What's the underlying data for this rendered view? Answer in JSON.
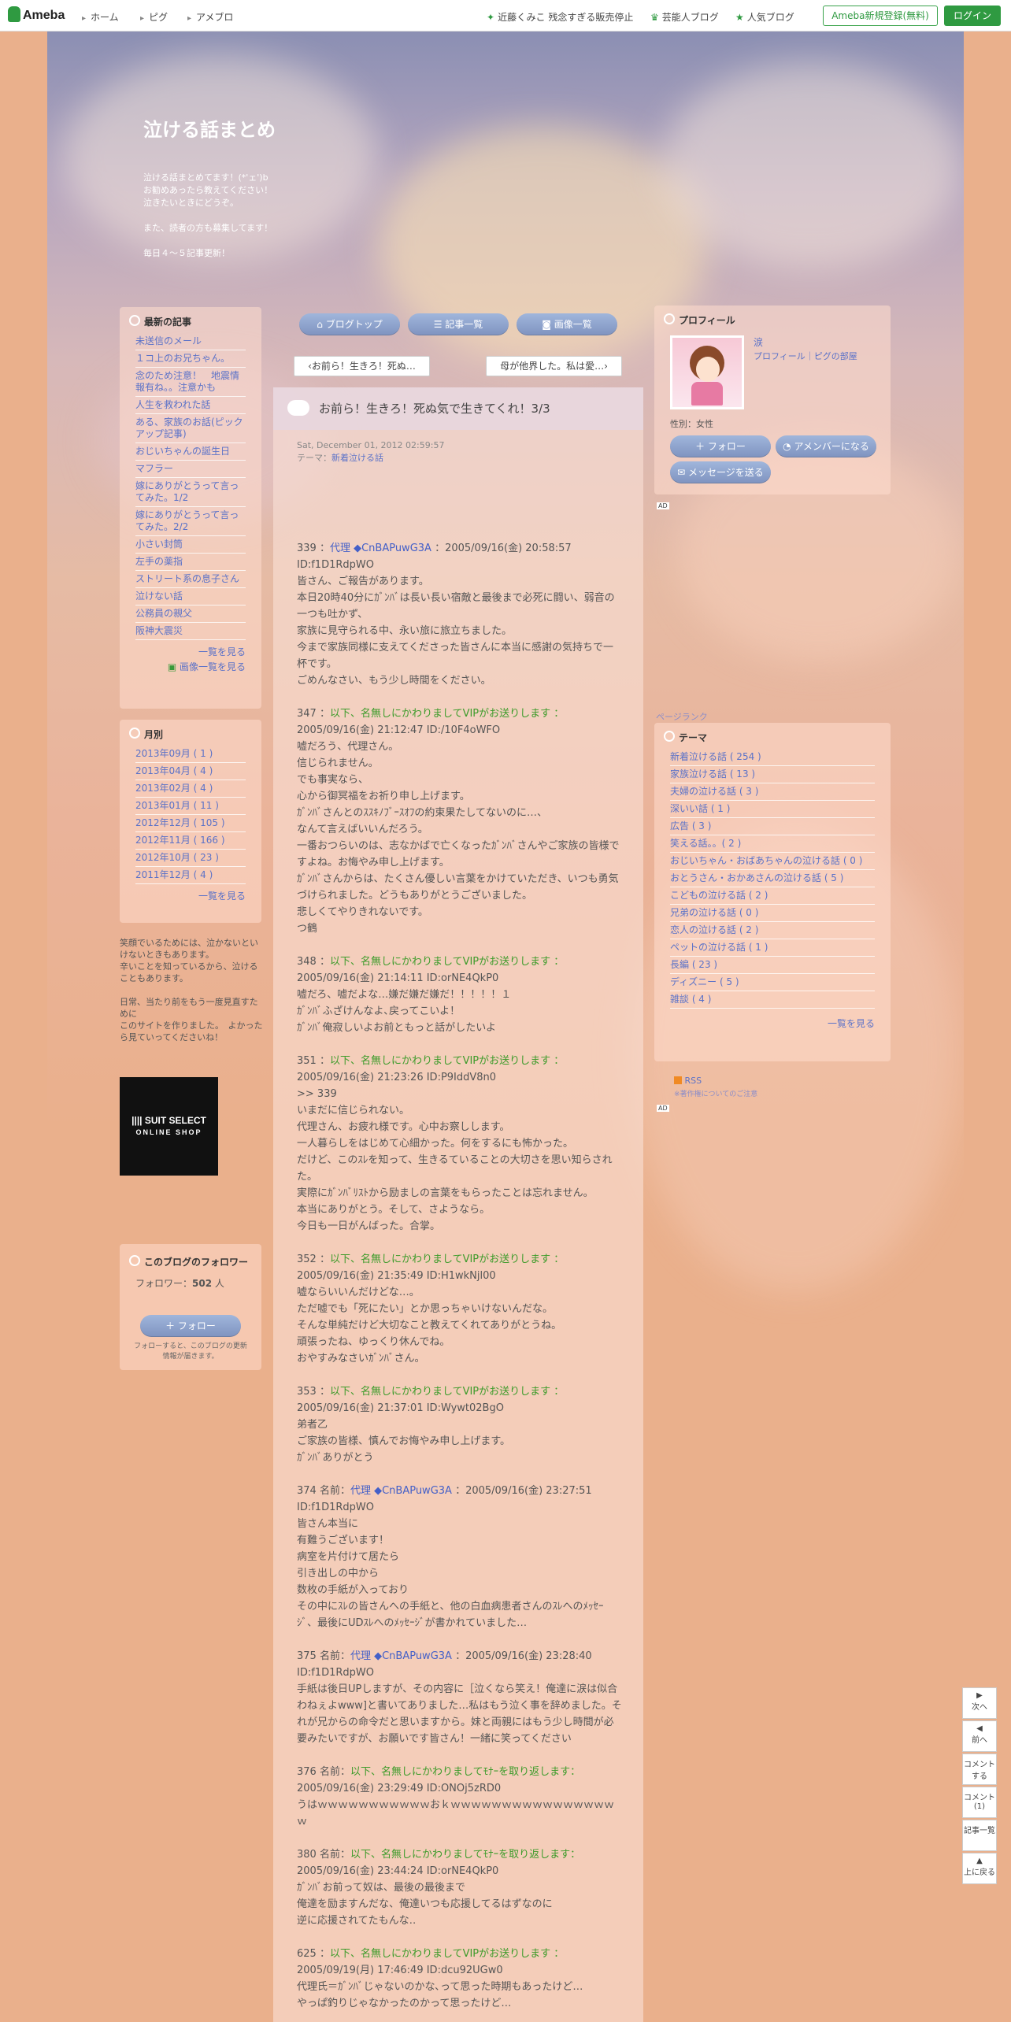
{
  "topbar": {
    "logo": "Ameba",
    "nav": [
      "ホーム",
      "ピグ",
      "アメブロ"
    ],
    "right": [
      "近藤くみこ 残念すぎる販売停止",
      "芸能人ブログ",
      "人気ブログ"
    ],
    "register": "Ameba新規登録(無料)",
    "login": "ログイン"
  },
  "blog": {
    "title": "泣ける話まとめ",
    "description": "泣ける話まとめてます！(*'ェ')b\nお勧めあったら教えてください！\n泣きたいときにどうぞ。\n\nまた、読者の方も募集してます！\n\n毎日４～５記事更新！"
  },
  "tabs": [
    "ブログトップ",
    "記事一覧",
    "画像一覧"
  ],
  "pager": {
    "prev": "お前ら！生きろ！死ぬ…",
    "next": "母が他界した。私は愛…"
  },
  "post": {
    "title": "お前ら！生きろ！死ぬ気で生きてくれ！3/3",
    "date": "Sat, December 01, 2012 02:59:57",
    "theme_label": "テーマ：",
    "theme": "新着泣ける話"
  },
  "left": {
    "recent": {
      "title": "最新の記事",
      "items": [
        "未送信のメール",
        "１コ上のお兄ちゃん。",
        "念のため注意！　地震情報有ね。。注意かも",
        "人生を救われた話",
        "ある、家族のお話(ピックアップ記事)",
        "おじいちゃんの誕生日",
        "マフラー",
        "嫁にありがとうって言ってみた。1/2",
        "嫁にありがとうって言ってみた。2/2",
        "小さい封筒",
        "左手の薬指",
        "ストリート系の息子さん",
        "泣けない話",
        "公務員の親父",
        "阪神大震災"
      ],
      "more": "一覧を見る",
      "image_more": "画像一覧を見る"
    },
    "monthly": {
      "title": "月別",
      "items": [
        "2013年09月 ( 1 )",
        "2013年04月 ( 4 )",
        "2013年02月 ( 4 )",
        "2013年01月 ( 11 )",
        "2012年12月 ( 105 )",
        "2012年11月 ( 166 )",
        "2012年10月 ( 23 )",
        "2011年12月 ( 4 )"
      ],
      "more": "一覧を見る"
    },
    "message": "笑顔でいるためには、泣かないといけないときもあります。\n辛いことを知っているから、泣けることもあります。\n\n日常、当たり前をもう一度見直すために\nこのサイトを作りました。　よかったら見ていってくださいね！",
    "ad": {
      "line1": "|||| SUIT SELECT",
      "line2": "ONLINE SHOP"
    },
    "follower": {
      "title": "このブログのフォロワー",
      "count_label": "フォロワー",
      "count": "502",
      "unit": "人",
      "button": "フォロー",
      "note": "フォローすると、このブログの更新情報が届きます。"
    }
  },
  "right": {
    "profile": {
      "title": "プロフィール",
      "name": "涙",
      "links": "プロフィール｜ピグの部屋",
      "gender": "性別：女性",
      "follow": "フォロー",
      "amember": "アメンバーになる",
      "message": "メッセージを送る"
    },
    "ad_label": "AD",
    "page_rank": "ページランク",
    "themes": {
      "title": "テーマ",
      "items": [
        "新着泣ける話 ( 254 )",
        "家族泣ける話 ( 13 )",
        "夫婦の泣ける話 ( 3 )",
        "深いい話 ( 1 )",
        "広告 ( 3 )",
        "笑える話。。( 2 )",
        "おじいちゃん・おばあちゃんの泣ける話 ( 0 )",
        "おとうさん・おかあさんの泣ける話 ( 5 )",
        "こどもの泣ける話 ( 2 )",
        "兄弟の泣ける話 ( 0 )",
        "恋人の泣ける話 ( 2 )",
        "ペットの泣ける話 ( 1 )",
        "長編 ( 23 )",
        "ディズニー ( 5 )",
        "雑談 ( 4 )"
      ],
      "more": "一覧を見る"
    },
    "rss": "RSS",
    "copyright": "※著作権についてのご注意"
  },
  "side_buttons": [
    "次へ",
    "前へ",
    "コメントする",
    "コメント(1)",
    "記事一覧",
    "上に戻る"
  ],
  "entries": [
    {
      "head": [
        {
          "t": "339 ："
        },
        {
          "t": "代理 ◆CnBAPuwG3A",
          "c": "bl"
        },
        {
          "t": " ：2005/09/16(金) 20:58:57 ID:f1D1RdpWO"
        }
      ],
      "lines": [
        "皆さん、ご報告があります。",
        "本日20時40分にｶﾞﾝﾊﾞは長い長い宿敵と最後まで必死に闘い、弱音の一つも吐かず、",
        "家族に見守られる中、永い旅に旅立ちました。",
        "今まで家族同様に支えてくださった皆さんに本当に感謝の気持ちで一杯です。",
        "ごめんなさい、もう少し時間をください。"
      ]
    },
    {
      "head": [
        {
          "t": "347 ："
        },
        {
          "t": "以下、名無しにかわりましてVIPがお送りします ：",
          "c": "gn"
        },
        {
          "t": "2005/09/16(金) 21:12:47 ID:/10F4oWFO"
        }
      ],
      "lines": [
        "嘘だろう、代理さん。",
        "信じられません。",
        "でも事実なら、",
        "心から御冥福をお祈り申し上げます。",
        "ｶﾞﾝﾊﾞさんとのｽｽｷﾉﾌﾞｰｽｵﾌの約束果たしてないのに…、",
        "なんて言えばいいんだろう。",
        "一番おつらいのは、志なかばで亡くなったｶﾞﾝﾊﾞさんやご家族の皆様ですよね。お悔やみ申し上げます。",
        "ｶﾞﾝﾊﾞさんからは、たくさん優しい言葉をかけていただき、いつも勇気づけられました。どうもありがとうございました。",
        "悲しくてやりきれないです。",
        "つ鶴"
      ]
    },
    {
      "head": [
        {
          "t": "348 ："
        },
        {
          "t": "以下、名無しにかわりましてVIPがお送りします ：",
          "c": "gn"
        },
        {
          "t": "2005/09/16(金) 21:14:11 ID:orNE4QkP0"
        }
      ],
      "lines": [
        "嘘だろ、嘘だよな…嫌だ嫌だ嫌だ！！！！！１",
        "ｶﾞﾝﾊﾞふざけんなよ､戻ってこいよ！",
        "ｶﾞﾝﾊﾞ俺寂しいよお前ともっと話がしたいよ"
      ]
    },
    {
      "head": [
        {
          "t": "351 ："
        },
        {
          "t": "以下、名無しにかわりましてVIPがお送りします ：",
          "c": "gn"
        },
        {
          "t": "2005/09/16(金) 21:23:26 ID:P9IddV8n0"
        }
      ],
      "lines": [
        ">> 339",
        "いまだに信じられない。",
        "代理さん、お疲れ様です。心中お察しします。",
        "一人暮らしをはじめて心細かった。何をするにも怖かった。",
        "だけど、このｽﾚを知って、生きるていることの大切さを思い知らされた。",
        "実際にｶﾞﾝﾊﾞﾘｽﾄから励ましの言葉をもらったことは忘れません。",
        "本当にありがとう。そして、さようなら。",
        "今日も一日がんばった。合掌。"
      ]
    },
    {
      "head": [
        {
          "t": "352 ："
        },
        {
          "t": "以下、名無しにかわりましてVIPがお送りします ：",
          "c": "gn"
        },
        {
          "t": "2005/09/16(金) 21:35:49 ID:H1wkNjl00"
        }
      ],
      "lines": [
        "嘘ならいいんだけどな…。",
        "ただ嘘でも「死にたい」とか思っちゃいけないんだな。",
        "そんな単純だけど大切なこと教えてくれてありがとうね。",
        "頑張ったね、ゆっくり休んでね。",
        "おやすみなさいｶﾞﾝﾊﾞさん。"
      ]
    },
    {
      "head": [
        {
          "t": "353 ："
        },
        {
          "t": "以下、名無しにかわりましてVIPがお送りします ：",
          "c": "gn"
        },
        {
          "t": "2005/09/16(金) 21:37:01 ID:Wywt02BgO"
        }
      ],
      "lines": [
        "弟者乙",
        "ご家族の皆様、慎んでお悔やみ申し上げます。",
        "ｶﾞﾝﾊﾞありがとう"
      ]
    },
    {
      "head": [
        {
          "t": "374 名前："
        },
        {
          "t": "代理 ◆CnBAPuwG3A",
          "c": "bl"
        },
        {
          "t": " ：2005/09/16(金) 23:27:51 ID:f1D1RdpWO"
        }
      ],
      "lines": [
        "皆さん本当に",
        "有難うございます！",
        "病室を片付けて居たら",
        "引き出しの中から",
        "数枚の手紙が入っており",
        "その中にｽﾚの皆さんへの手紙と、他の白血病患者さんのｽﾚへのﾒｯｾｰｼﾞ、最後にUDｽﾚへのﾒｯｾｰｼﾞが書かれていました…"
      ]
    },
    {
      "head": [
        {
          "t": "375 名前："
        },
        {
          "t": "代理 ◆CnBAPuwG3A",
          "c": "bl"
        },
        {
          "t": " ：2005/09/16(金) 23:28:40 ID:f1D1RdpWO"
        }
      ],
      "lines": [
        "手紙は後日UPしますが、その内容に［泣くなら笑え！俺達に涙は似合わねぇよwww]と書いてありました…私はもう泣く事を辞めました。それが兄からの命令だと思いますから。妹と両親にはもう少し時間が必要みたいですが、お願いです皆さん！一緒に笑ってください"
      ]
    },
    {
      "head": [
        {
          "t": "376 名前："
        },
        {
          "t": "以下、名無しにかわりましてﾓﾅｰを取り返します：",
          "c": "gn"
        },
        {
          "t": "2005/09/16(金) 23:29:49 ID:ONOj5zRD0"
        }
      ],
      "lines": [
        "うはｗｗｗｗｗｗｗｗｗｗｗおｋｗｗｗｗｗｗｗｗｗｗｗｗｗｗｗｗｗ"
      ]
    },
    {
      "head": [
        {
          "t": "380 名前："
        },
        {
          "t": "以下、名無しにかわりましてﾓﾅｰを取り返します：",
          "c": "gn"
        },
        {
          "t": "2005/09/16(金) 23:44:24 ID:orNE4QkP0"
        }
      ],
      "lines": [
        "ｶﾞﾝﾊﾞお前って奴は、最後の最後まで",
        "俺達を励ますんだな、俺達いつも応援してるはずなのに",
        "逆に応援されてたもんな‥"
      ]
    },
    {
      "head": [
        {
          "t": "625 ："
        },
        {
          "t": "以下、名無しにかわりましてVIPがお送りします ：",
          "c": "gn"
        },
        {
          "t": "2005/09/19(月) 17:46:49 ID:dcu92UGw0"
        }
      ],
      "lines": [
        "代理氏＝ｶﾞﾝﾊﾞじゃないのかな､って思った時期もあったけど…",
        "やっぱ釣りじゃなかったのかって思ったけど…"
      ]
    }
  ]
}
